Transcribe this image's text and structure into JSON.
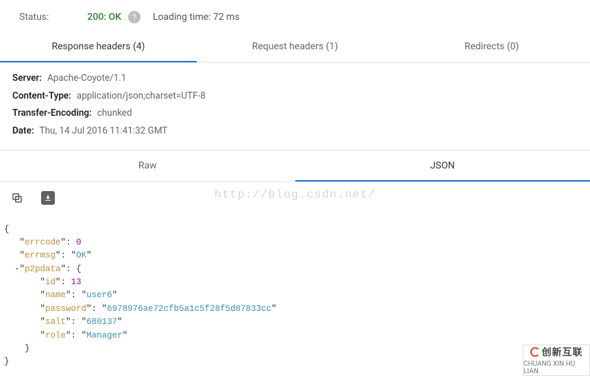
{
  "status": {
    "label": "Status:",
    "code_text": "200: OK",
    "loading_prefix": "Loading time:",
    "loading_value": "72 ms"
  },
  "tabs": {
    "response_headers": "Response headers (4)",
    "request_headers": "Request headers (1)",
    "redirects": "Redirects (0)"
  },
  "response_headers": [
    {
      "key": "Server:",
      "value": "Apache-Coyote/1.1"
    },
    {
      "key": "Content-Type:",
      "value": "application/json;charset=UTF-8"
    },
    {
      "key": "Transfer-Encoding:",
      "value": "chunked"
    },
    {
      "key": "Date:",
      "value": "Thu, 14 Jul 2016 11:41:32 GMT"
    }
  ],
  "view_tabs": {
    "raw": "Raw",
    "json": "JSON"
  },
  "watermark": "http://blog.csdn.net/",
  "json_payload": {
    "errcode": 0,
    "errmsg": "OK",
    "p2pdata": {
      "id": 13,
      "name": "user6",
      "password": "6978976ae72cfb5a1c5f28f5d87833cc",
      "salt": "680137",
      "role": "Manager"
    }
  },
  "logo": {
    "brand_cn": "创新互联",
    "brand_py": "CHUANG XIN HU LIAN"
  }
}
